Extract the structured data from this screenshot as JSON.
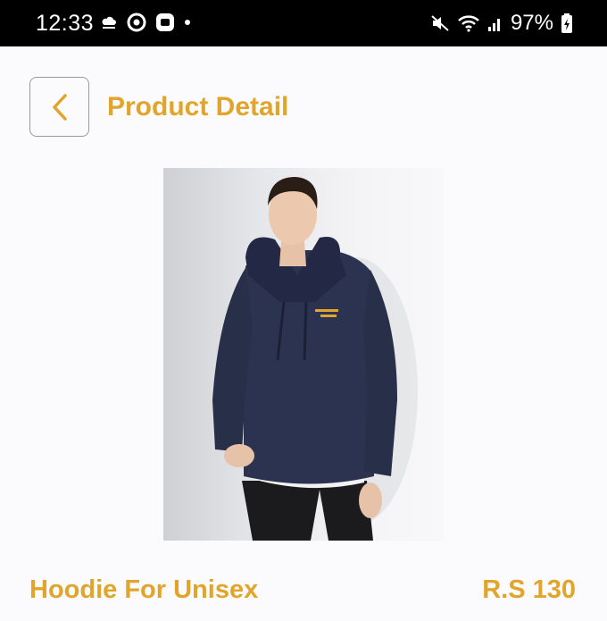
{
  "status_bar": {
    "time": "12:33",
    "battery": "97%",
    "icons_left": [
      "cloud-icon",
      "chrome-icon",
      "app-icon",
      "dot-icon"
    ],
    "icons_right": [
      "mute-icon",
      "wifi-icon",
      "signal-icon",
      "battery-icon"
    ]
  },
  "header": {
    "back_icon": "chevron-left-icon",
    "title": "Product Detail"
  },
  "product": {
    "image_alt": "Hoodie",
    "name": "Hoodie For Unisex",
    "price": "R.S 130"
  },
  "colors": {
    "accent": "#e0a52a",
    "background": "#fbfbfd",
    "status_bar": "#000000",
    "hoodie": "#2c3350"
  }
}
